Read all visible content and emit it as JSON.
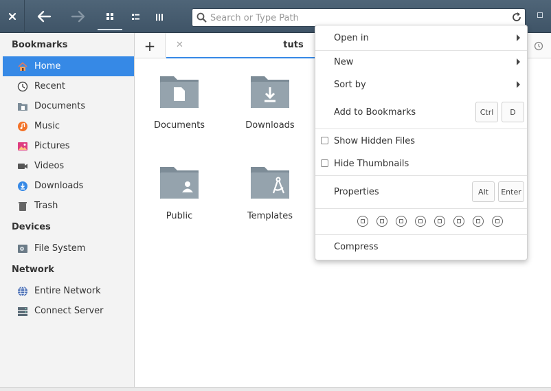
{
  "header": {
    "search_placeholder": "Search or Type Path"
  },
  "sidebar": {
    "bookmarks_title": "Bookmarks",
    "bookmarks": [
      {
        "label": "Home",
        "icon": "home-icon"
      },
      {
        "label": "Recent",
        "icon": "clock-icon"
      },
      {
        "label": "Documents",
        "icon": "documents-folder-icon"
      },
      {
        "label": "Music",
        "icon": "music-icon"
      },
      {
        "label": "Pictures",
        "icon": "pictures-icon"
      },
      {
        "label": "Videos",
        "icon": "video-camera-icon"
      },
      {
        "label": "Downloads",
        "icon": "download-icon"
      },
      {
        "label": "Trash",
        "icon": "trash-icon"
      }
    ],
    "devices_title": "Devices",
    "devices": [
      {
        "label": "File System",
        "icon": "drive-icon"
      }
    ],
    "network_title": "Network",
    "network": [
      {
        "label": "Entire Network",
        "icon": "globe-icon"
      },
      {
        "label": "Connect Server",
        "icon": "server-icon"
      }
    ]
  },
  "tabs": [
    {
      "label": "tuts"
    }
  ],
  "files": [
    {
      "name": "Documents",
      "icon": "documents-folder-icon"
    },
    {
      "name": "Downloads",
      "icon": "downloads-folder-icon"
    },
    {
      "name": "Public",
      "icon": "public-folder-icon"
    },
    {
      "name": "Templates",
      "icon": "templates-folder-icon"
    }
  ],
  "menu": {
    "open_in": "Open in",
    "new": "New",
    "sort_by": "Sort by",
    "add_to_bookmarks": "Add to Bookmarks",
    "add_to_bookmarks_keys": [
      "Ctrl",
      "D"
    ],
    "show_hidden_files": "Show Hidden Files",
    "show_hidden_files_checked": false,
    "hide_thumbnails": "Hide Thumbnails",
    "hide_thumbnails_checked": false,
    "properties": "Properties",
    "properties_keys": [
      "Alt",
      "Enter"
    ],
    "color_tags_count": 8,
    "compress": "Compress"
  },
  "colors": {
    "header_bg": "#485d70",
    "selection": "#3689e6",
    "folder": "#95a3ad"
  }
}
